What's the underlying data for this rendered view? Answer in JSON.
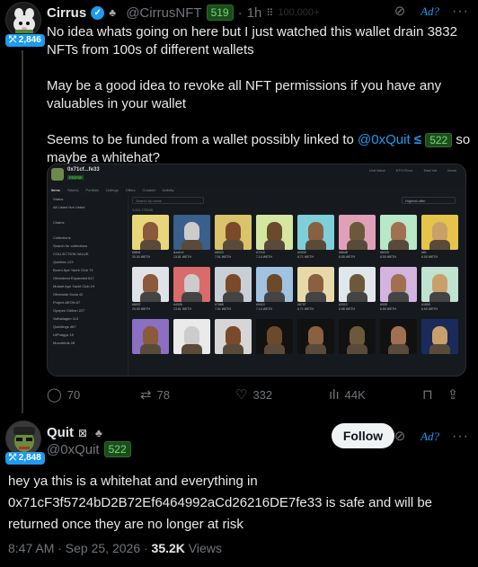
{
  "tweet": {
    "author_name": "Cirrus",
    "handle": "@CirrusNFT",
    "handle_badge": "519",
    "time": "1h",
    "faint_text": "100,000+",
    "follower_badge": "2,846",
    "ad_label": "Ad?",
    "more": "···",
    "paragraphs": [
      "No idea whats going on here but I just watched this wallet drain 3832 NFTs from 100s of different wallets",
      "May be a good idea to revoke all NFT permissions if you have any valuables in your wallet"
    ],
    "p3_before": "Seems to be funded from a wallet possibly linked to ",
    "p3_mention": "@0xQuit",
    "p3_badge": "522",
    "p3_after": " so maybe a whitehat?",
    "actions": {
      "replies": "70",
      "retweets": "78",
      "likes": "332",
      "views": "44K"
    }
  },
  "media": {
    "collection_title": "0x71cf...fe33",
    "collection_sub": "FE2F0F",
    "stats": [
      "Unit Value",
      "ETH Floor",
      "Total Vol",
      "Items"
    ],
    "tabs": [
      "Items",
      "Tokens",
      "Portfolio",
      "Listings",
      "Offers",
      "Created",
      "Activity"
    ],
    "sidebar": [
      "Status",
      "All   Listed   Not Listed",
      "Chains",
      "Collections",
      "Search for collections",
      "COLLECTION                 VALUE",
      "Quirkies                     123",
      "Bored Ape Yacht Club    74",
      "Otherdeed Expanded     617",
      "Mutant Ape Yacht Club   19",
      "Otherside Koda             42",
      "Project AEON               67",
      "Opepen Edition           227",
      "Valhallagen                 113",
      "Quirklings                   467",
      "LilPudgys                    19",
      "Moonbirds                  28"
    ],
    "search_placeholder": "Search by name",
    "sort_label": "Highest offer",
    "count_label": "3,831 ITEMS",
    "row1_caps": [
      "#6841",
      "Azuki #",
      "#6923",
      "#7218",
      "#2930",
      "#6648",
      "#6225",
      "#81"
    ],
    "row2_caps": [
      "#6637",
      "#4326",
      "#7668",
      "#9410",
      "#6707",
      "#2012",
      "#935",
      "#1859"
    ],
    "price_caps": [
      "20.00 WETH",
      "13.81 WETH",
      "7.51 WETH",
      "7.14 WETH",
      "6.71 WETH",
      "6.55 WETH",
      "6.50 WETH",
      "6.50 WETH"
    ]
  },
  "reply": {
    "author_name": "Quit",
    "handle": "@0xQuit",
    "handle_badge": "522",
    "follower_badge": "2,848",
    "follow_label": "Follow",
    "ad_label": "Ad?",
    "more": "···",
    "text": "hey ya this is a whitehat and everything in 0x71cF3f5724bD2B72Ef6464992aCd26216DE7fe33 is safe and will be returned once they are no longer at risk",
    "timestamp": "8:47 AM · Sep 25, 2026 · ",
    "views_count": "35.2K",
    "views_label": " Views"
  },
  "colors": {
    "accent": "#1d9bf0",
    "background": "#000000",
    "follow_button": "#eff3f4",
    "badge_green": "#7bd67b"
  }
}
